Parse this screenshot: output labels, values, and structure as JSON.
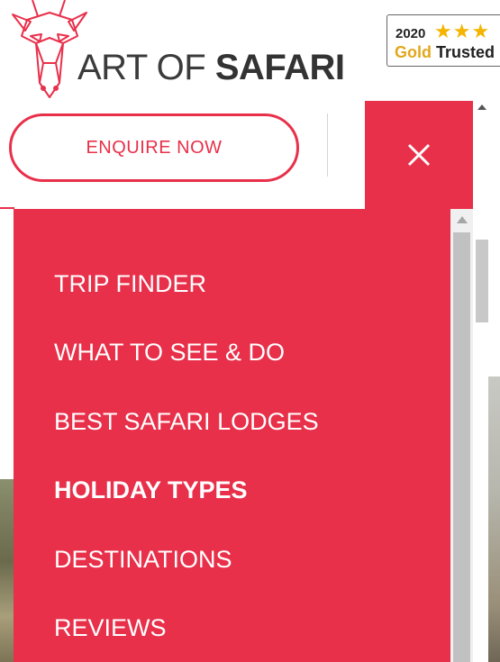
{
  "brand": {
    "name_light": "ART OF ",
    "name_bold": "SAFARI",
    "logo_icon": "giraffe-icon",
    "accent_color": "#e8304a"
  },
  "badge": {
    "year": "2020",
    "stars": "★★★",
    "label_gold": "Gold",
    "label_rest": " Trusted"
  },
  "header": {
    "enquire_label": "ENQUIRE NOW",
    "close_icon": "close-icon"
  },
  "menu": {
    "items": [
      {
        "label": "TRIP FINDER",
        "active": false
      },
      {
        "label": "WHAT TO SEE & DO",
        "active": false
      },
      {
        "label": "BEST SAFARI LODGES",
        "active": false
      },
      {
        "label": "HOLIDAY TYPES",
        "active": true
      },
      {
        "label": "DESTINATIONS",
        "active": false
      },
      {
        "label": "REVIEWS",
        "active": false
      }
    ]
  }
}
